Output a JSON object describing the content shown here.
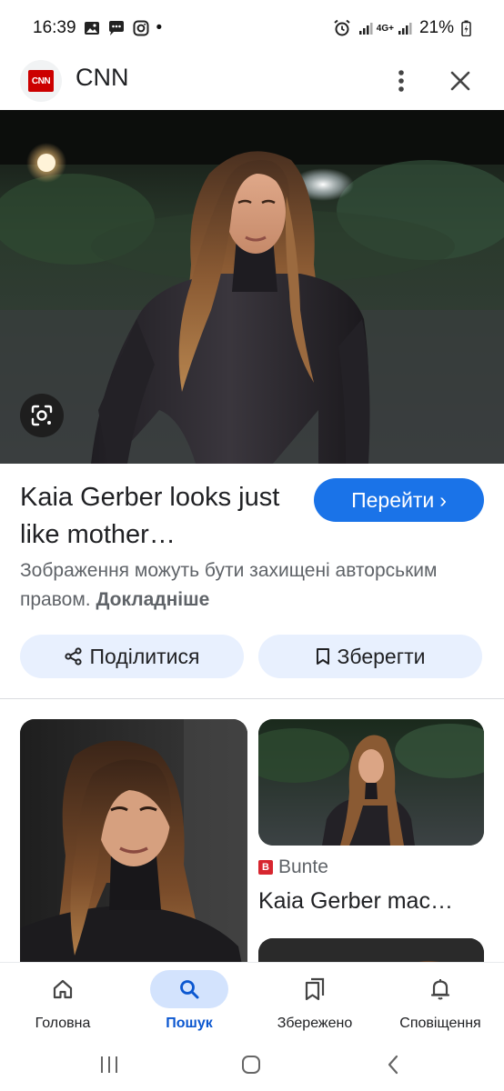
{
  "status_bar": {
    "time": "16:39",
    "battery": "21%",
    "network": "4G+",
    "dot": "•"
  },
  "header": {
    "logo_text": "CNN",
    "site_name": "CNN",
    "more_icon": "more-vert-icon",
    "close_icon": "close-icon"
  },
  "image_viewer": {
    "lens_icon": "google-lens-icon",
    "title": "Kaia Gerber looks just like mother…",
    "goto_label": "Перейти",
    "goto_chevron": "›",
    "copyright_text": "Зображення можуть бути захищені авторським правом.",
    "learn_more": "Докладніше",
    "share_label": "Поділитися",
    "save_label": "Зберегти"
  },
  "related": {
    "item2": {
      "source_icon_text": "B",
      "source": "Bunte",
      "title": "Kaia Gerber mac…"
    }
  },
  "bottom_nav": {
    "items": [
      {
        "label": "Головна",
        "icon": "home-icon"
      },
      {
        "label": "Пошук",
        "icon": "search-icon",
        "active": true
      },
      {
        "label": "Збережено",
        "icon": "collections-icon"
      },
      {
        "label": "Сповіщення",
        "icon": "bell-icon"
      }
    ]
  },
  "colors": {
    "accent": "#1a73e8",
    "pill_bg": "#e8f0fe",
    "nav_active_bg": "#d3e3fd",
    "cnn_red": "#cc0000"
  }
}
